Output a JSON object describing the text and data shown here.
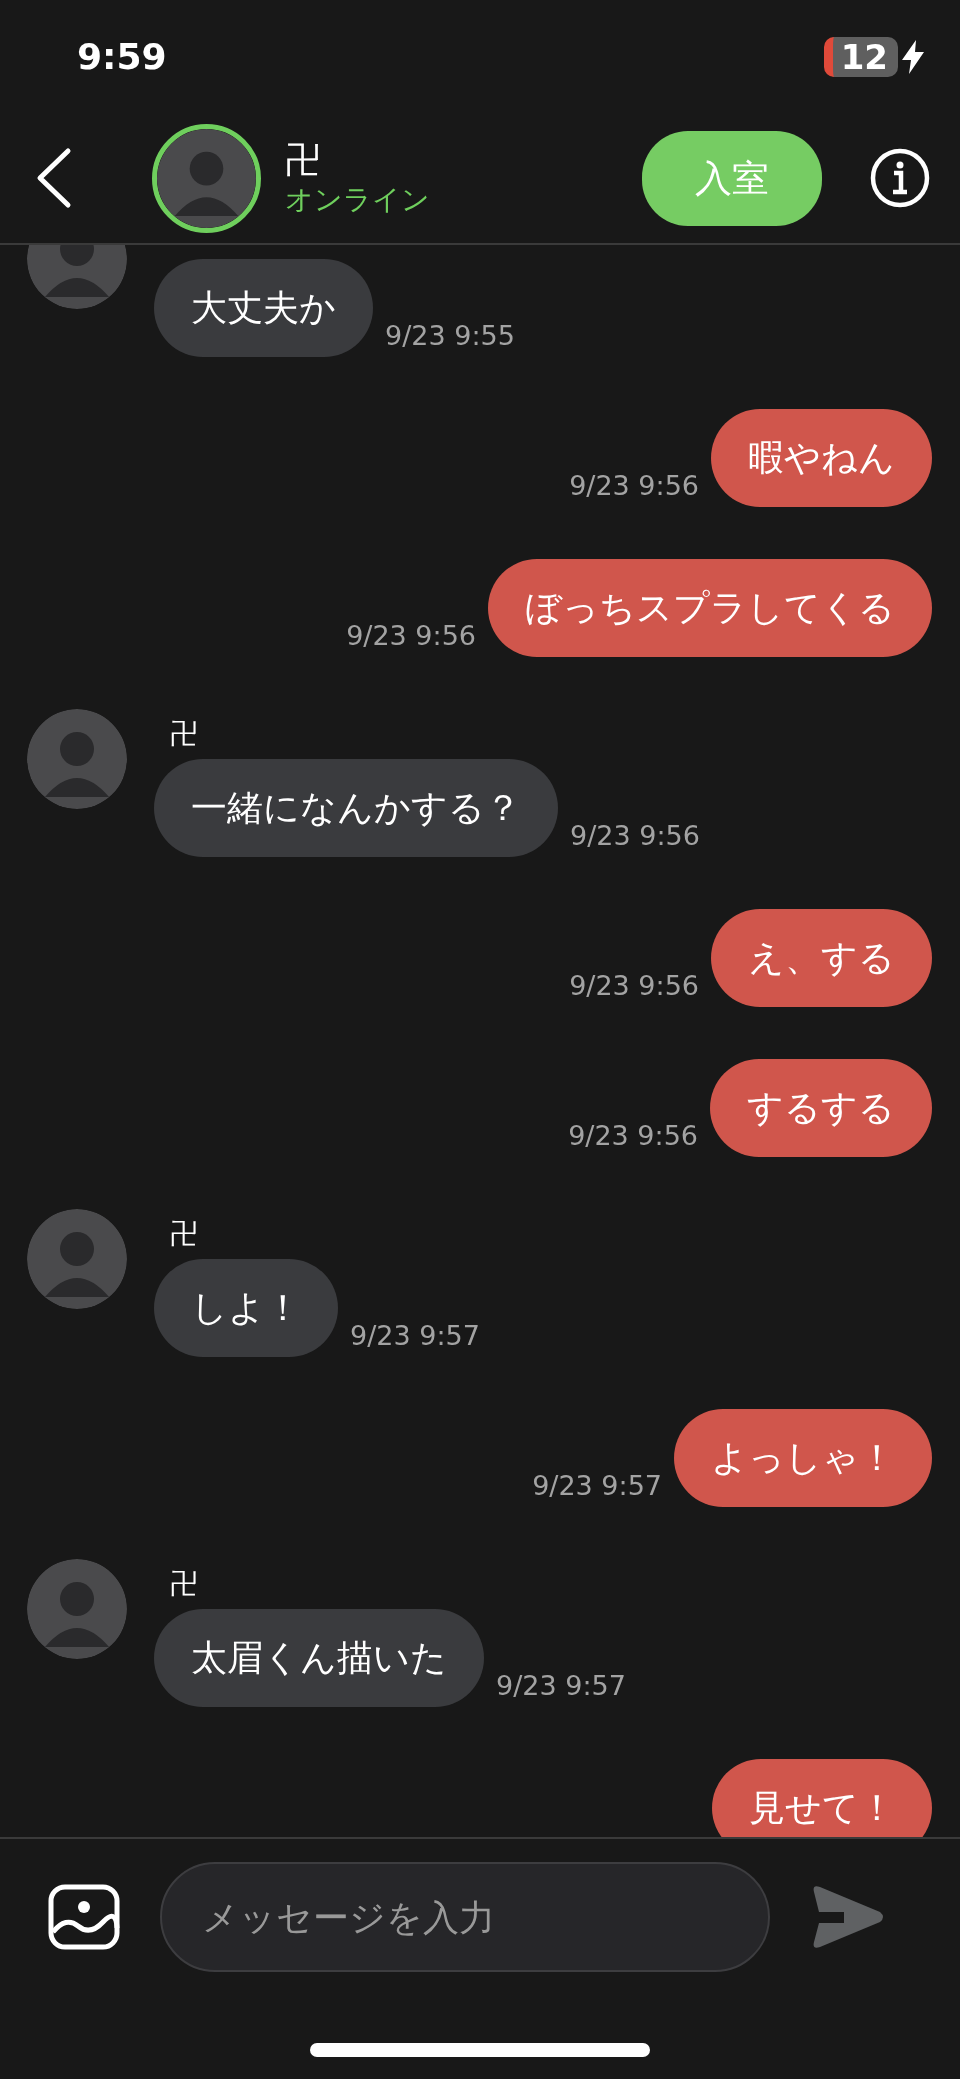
{
  "status_bar": {
    "time": "9:59",
    "battery": "12"
  },
  "header": {
    "name": "卍",
    "status": "オンライン",
    "button": "入室"
  },
  "messages": [
    {
      "kind": "received",
      "text": "大丈夫か",
      "time": "9/23 9:55"
    },
    {
      "kind": "sent",
      "text": "暇やねん",
      "time": "9/23 9:56"
    },
    {
      "kind": "sent",
      "text": "ぼっちスプラしてくる",
      "time": "9/23 9:56"
    },
    {
      "kind": "received",
      "sender": "卍",
      "text": "一緒になんかする？",
      "time": "9/23 9:56"
    },
    {
      "kind": "sent",
      "text": "え、する",
      "time": "9/23 9:56"
    },
    {
      "kind": "sent",
      "text": "するする",
      "time": "9/23 9:56"
    },
    {
      "kind": "received",
      "sender": "卍",
      "text": "しよ！",
      "time": "9/23 9:57"
    },
    {
      "kind": "sent",
      "text": "よっしゃ！",
      "time": "9/23 9:57"
    },
    {
      "kind": "received",
      "sender": "卍",
      "text": "太眉くん描いた",
      "time": "9/23 9:57"
    },
    {
      "kind": "sent",
      "text": "見せて！"
    }
  ],
  "composer": {
    "placeholder": "メッセージを入力"
  }
}
